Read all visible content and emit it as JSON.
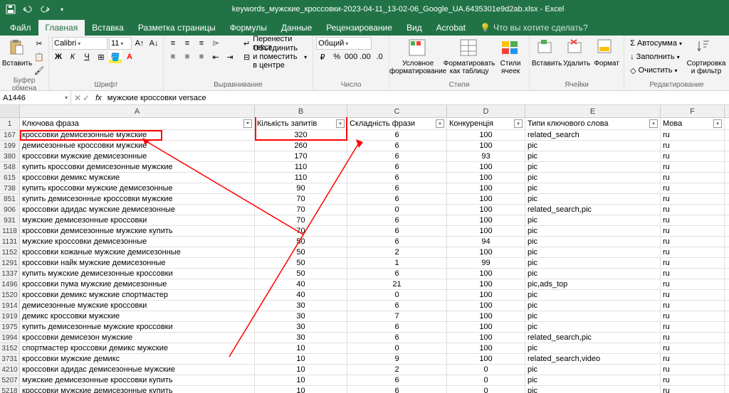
{
  "title": "keywords_мужские_кроссовки-2023-04-11_13-02-06_Google_UA.6435301e9d2ab.xlsx - Excel",
  "menu": {
    "file": "Файл"
  },
  "tabs": [
    "Главная",
    "Вставка",
    "Разметка страницы",
    "Формулы",
    "Данные",
    "Рецензирование",
    "Вид",
    "Acrobat"
  ],
  "tell_me": "Что вы хотите сделать?",
  "ribbon": {
    "clipboard": {
      "label": "Буфер обмена",
      "paste": "Вставить"
    },
    "font": {
      "label": "Шрифт",
      "name": "Calibri",
      "size": "11"
    },
    "align": {
      "label": "Выравнивание",
      "wrap": "Перенести текст",
      "merge": "Объединить и поместить в центре"
    },
    "number": {
      "label": "Число",
      "format": "Общий"
    },
    "styles": {
      "label": "Стили",
      "cond": "Условное форматирование",
      "table": "Форматировать как таблицу",
      "cell": "Стили ячеек"
    },
    "cells": {
      "label": "Ячейки",
      "insert": "Вставить",
      "delete": "Удалить",
      "format": "Формат"
    },
    "editing": {
      "label": "Редактирование",
      "sum": "Автосумма",
      "fill": "Заполнить",
      "clear": "Очистить",
      "sort": "Сортировка и фильтр"
    }
  },
  "namebox": "A1446",
  "formula": "мужские кроссовки versace",
  "cols": [
    "A",
    "B",
    "C",
    "D",
    "E",
    "F"
  ],
  "headers": [
    "Ключова фраза",
    "Кількість запитів",
    "Складність фрази",
    "Конкуренція",
    "Типи ключового слова",
    "Мова"
  ],
  "rows": [
    {
      "n": 167,
      "a": "кроссовки демисезонные мужские",
      "b": 320,
      "c": 6,
      "d": 100,
      "e": "related_search",
      "f": "ru"
    },
    {
      "n": 199,
      "a": "демисезонные кроссовки мужские",
      "b": 260,
      "c": 6,
      "d": 100,
      "e": "pic",
      "f": "ru"
    },
    {
      "n": 380,
      "a": "кроссовки мужские демисезонные",
      "b": 170,
      "c": 6,
      "d": 93,
      "e": "pic",
      "f": "ru"
    },
    {
      "n": 548,
      "a": "купить кроссовки демисезонные мужские",
      "b": 110,
      "c": 6,
      "d": 100,
      "e": "pic",
      "f": "ru"
    },
    {
      "n": 615,
      "a": "кроссовки демикс мужские",
      "b": 110,
      "c": 6,
      "d": 100,
      "e": "pic",
      "f": "ru"
    },
    {
      "n": 738,
      "a": "купить кроссовки мужские демисезонные",
      "b": 90,
      "c": 6,
      "d": 100,
      "e": "pic",
      "f": "ru"
    },
    {
      "n": 851,
      "a": "купить демисезонные кроссовки мужские",
      "b": 70,
      "c": 6,
      "d": 100,
      "e": "pic",
      "f": "ru"
    },
    {
      "n": 906,
      "a": "кроссовки адидас мужские демисезонные",
      "b": 70,
      "c": 0,
      "d": 100,
      "e": "related_search,pic",
      "f": "ru"
    },
    {
      "n": 931,
      "a": "мужские демисезонные кроссовки",
      "b": 70,
      "c": 6,
      "d": 100,
      "e": "pic",
      "f": "ru"
    },
    {
      "n": 1118,
      "a": "кроссовки демисезонные мужские купить",
      "b": 70,
      "c": 6,
      "d": 100,
      "e": "pic",
      "f": "ru"
    },
    {
      "n": 1131,
      "a": "мужские кроссовки демисезонные",
      "b": 50,
      "c": 6,
      "d": 94,
      "e": "pic",
      "f": "ru"
    },
    {
      "n": 1152,
      "a": "кроссовки кожаные мужские демисезонные",
      "b": 50,
      "c": 2,
      "d": 100,
      "e": "pic",
      "f": "ru"
    },
    {
      "n": 1291,
      "a": "кроссовки найк мужские демисезонные",
      "b": 50,
      "c": 1,
      "d": 99,
      "e": "pic",
      "f": "ru"
    },
    {
      "n": 1337,
      "a": "купить мужские демисезонные кроссовки",
      "b": 50,
      "c": 6,
      "d": 100,
      "e": "pic",
      "f": "ru"
    },
    {
      "n": 1496,
      "a": "кроссовки пума мужские демисезонные",
      "b": 40,
      "c": 21,
      "d": 100,
      "e": "pic,ads_top",
      "f": "ru"
    },
    {
      "n": 1520,
      "a": "кроссовки демикс мужские спортмастер",
      "b": 40,
      "c": 0,
      "d": 100,
      "e": "pic",
      "f": "ru"
    },
    {
      "n": 1914,
      "a": "демисезонные мужские кроссовки",
      "b": 30,
      "c": 6,
      "d": 100,
      "e": "pic",
      "f": "ru"
    },
    {
      "n": 1919,
      "a": "демикс кроссовки мужские",
      "b": 30,
      "c": 7,
      "d": 100,
      "e": "pic",
      "f": "ru"
    },
    {
      "n": 1975,
      "a": "купить демисезонные мужские кроссовки",
      "b": 30,
      "c": 6,
      "d": 100,
      "e": "pic",
      "f": "ru"
    },
    {
      "n": 1994,
      "a": "кроссовки демисезон мужские",
      "b": 30,
      "c": 6,
      "d": 100,
      "e": "related_search,pic",
      "f": "ru"
    },
    {
      "n": 3152,
      "a": "спортмастер кроссовки демикс мужские",
      "b": 10,
      "c": 0,
      "d": 100,
      "e": "pic",
      "f": "ru"
    },
    {
      "n": 3731,
      "a": "кроссовки мужские демикс",
      "b": 10,
      "c": 9,
      "d": 100,
      "e": "related_search,video",
      "f": "ru"
    },
    {
      "n": 4210,
      "a": "кроссовки адидас демисезонные мужские",
      "b": 10,
      "c": 2,
      "d": 0,
      "e": "pic",
      "f": "ru"
    },
    {
      "n": 5207,
      "a": "мужские демисезонные кроссовки купить",
      "b": 10,
      "c": 6,
      "d": 0,
      "e": "pic",
      "f": "ru"
    },
    {
      "n": 5218,
      "a": "кроссовки мужские демисезонные купить",
      "b": 10,
      "c": 6,
      "d": 0,
      "e": "pic",
      "f": "ru"
    }
  ]
}
